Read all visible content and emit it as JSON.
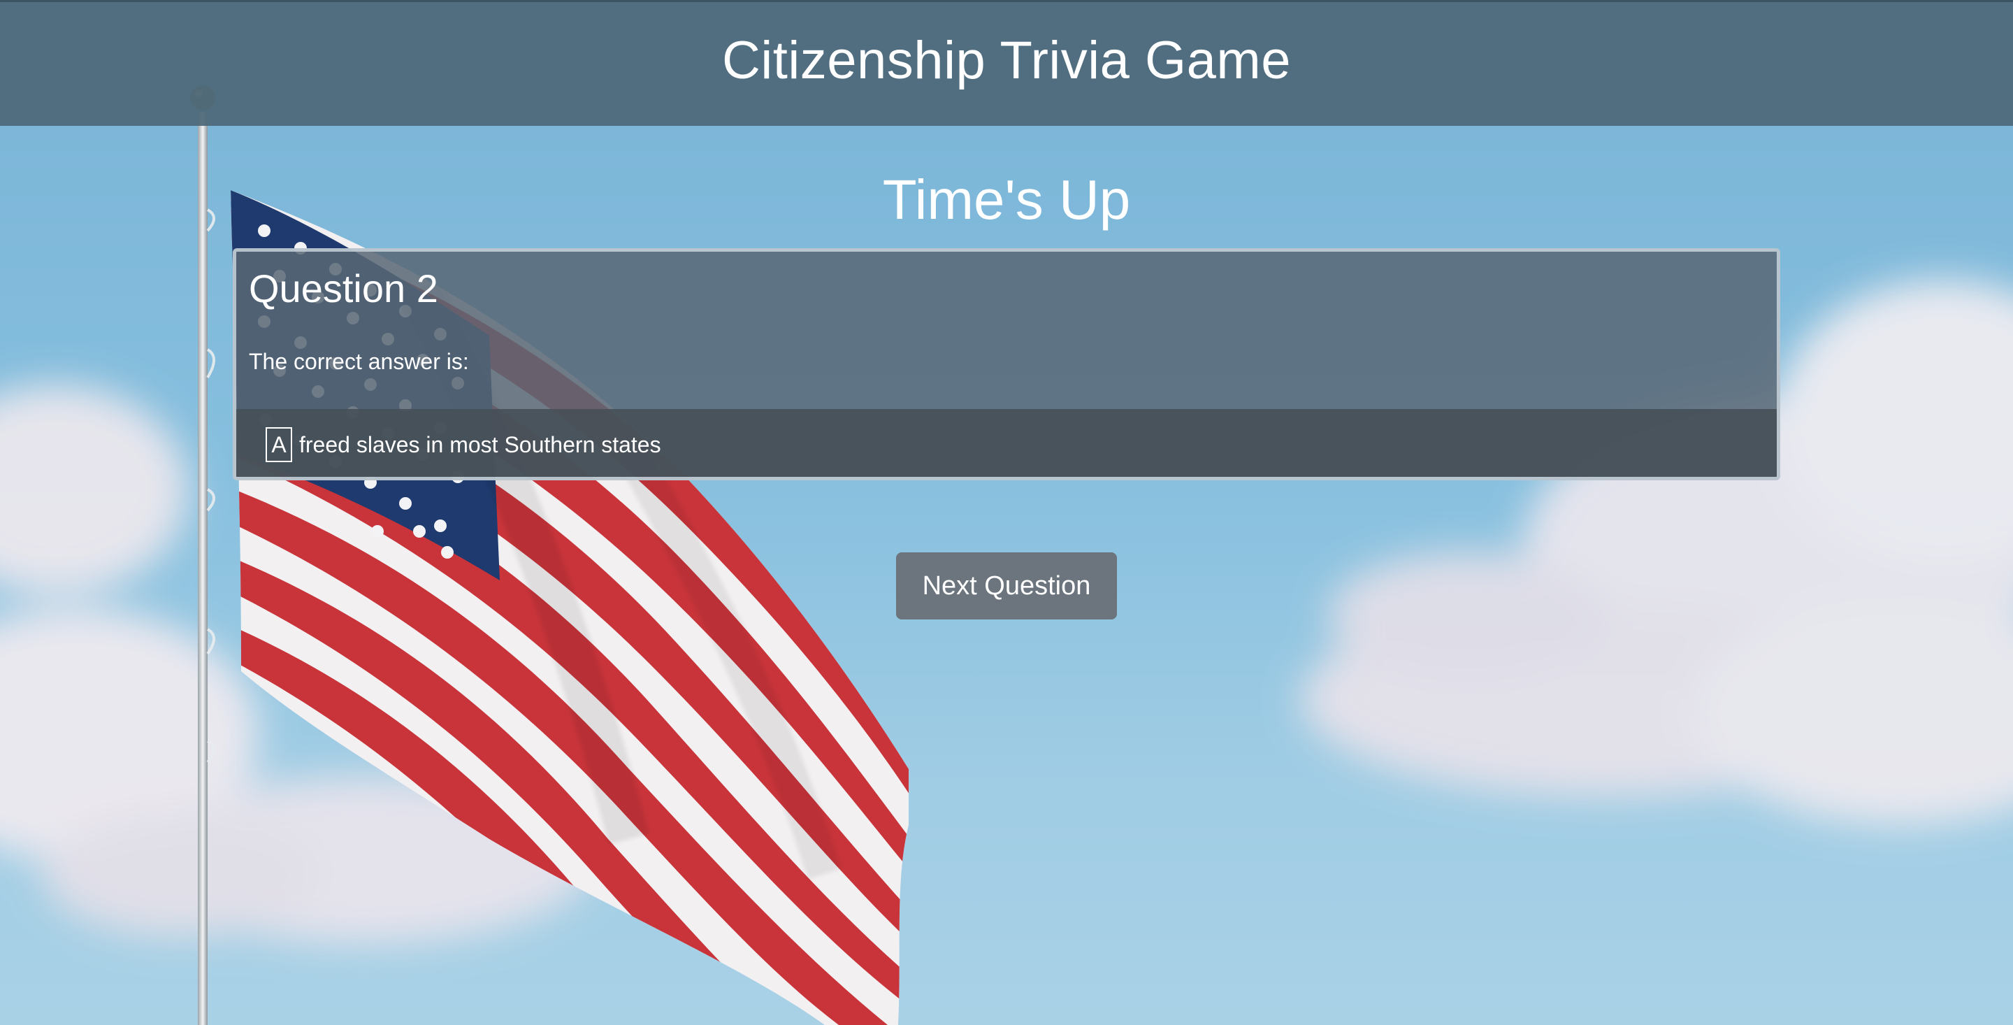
{
  "header": {
    "title": "Citizenship Trivia Game"
  },
  "main": {
    "status": "Time's Up",
    "question": {
      "title": "Question 2",
      "prompt": "The correct answer is:",
      "answer_letter": "A",
      "answer_text": "freed slaves in most Southern states"
    },
    "next_button_label": "Next Question"
  },
  "colors": {
    "sky": "#79b3d6",
    "header_bg": "#4e687a",
    "card_bg": "#586876",
    "answer_row_bg": "#464e56",
    "button_bg": "#6c757d",
    "flag_red": "#c8343a",
    "flag_blue": "#1e3a6e",
    "text": "#ffffff"
  }
}
